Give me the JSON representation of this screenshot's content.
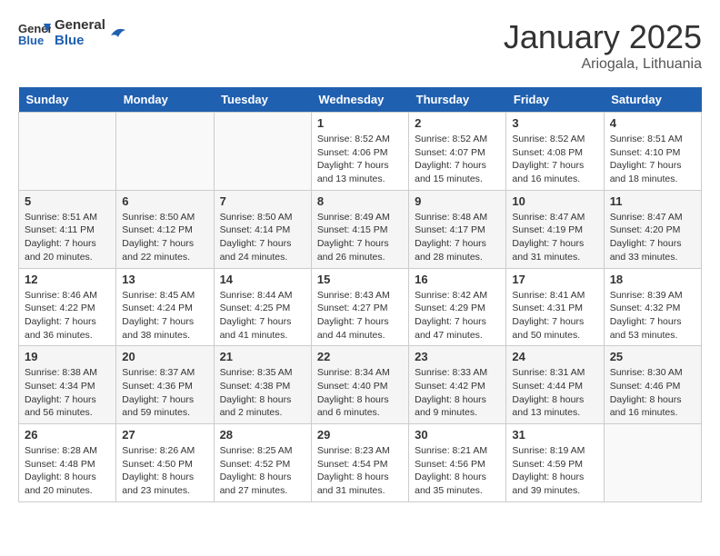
{
  "header": {
    "logo_general": "General",
    "logo_blue": "Blue",
    "month_title": "January 2025",
    "location": "Ariogala, Lithuania"
  },
  "days_of_week": [
    "Sunday",
    "Monday",
    "Tuesday",
    "Wednesday",
    "Thursday",
    "Friday",
    "Saturday"
  ],
  "weeks": [
    [
      {
        "day": "",
        "info": ""
      },
      {
        "day": "",
        "info": ""
      },
      {
        "day": "",
        "info": ""
      },
      {
        "day": "1",
        "info": "Sunrise: 8:52 AM\nSunset: 4:06 PM\nDaylight: 7 hours\nand 13 minutes."
      },
      {
        "day": "2",
        "info": "Sunrise: 8:52 AM\nSunset: 4:07 PM\nDaylight: 7 hours\nand 15 minutes."
      },
      {
        "day": "3",
        "info": "Sunrise: 8:52 AM\nSunset: 4:08 PM\nDaylight: 7 hours\nand 16 minutes."
      },
      {
        "day": "4",
        "info": "Sunrise: 8:51 AM\nSunset: 4:10 PM\nDaylight: 7 hours\nand 18 minutes."
      }
    ],
    [
      {
        "day": "5",
        "info": "Sunrise: 8:51 AM\nSunset: 4:11 PM\nDaylight: 7 hours\nand 20 minutes."
      },
      {
        "day": "6",
        "info": "Sunrise: 8:50 AM\nSunset: 4:12 PM\nDaylight: 7 hours\nand 22 minutes."
      },
      {
        "day": "7",
        "info": "Sunrise: 8:50 AM\nSunset: 4:14 PM\nDaylight: 7 hours\nand 24 minutes."
      },
      {
        "day": "8",
        "info": "Sunrise: 8:49 AM\nSunset: 4:15 PM\nDaylight: 7 hours\nand 26 minutes."
      },
      {
        "day": "9",
        "info": "Sunrise: 8:48 AM\nSunset: 4:17 PM\nDaylight: 7 hours\nand 28 minutes."
      },
      {
        "day": "10",
        "info": "Sunrise: 8:47 AM\nSunset: 4:19 PM\nDaylight: 7 hours\nand 31 minutes."
      },
      {
        "day": "11",
        "info": "Sunrise: 8:47 AM\nSunset: 4:20 PM\nDaylight: 7 hours\nand 33 minutes."
      }
    ],
    [
      {
        "day": "12",
        "info": "Sunrise: 8:46 AM\nSunset: 4:22 PM\nDaylight: 7 hours\nand 36 minutes."
      },
      {
        "day": "13",
        "info": "Sunrise: 8:45 AM\nSunset: 4:24 PM\nDaylight: 7 hours\nand 38 minutes."
      },
      {
        "day": "14",
        "info": "Sunrise: 8:44 AM\nSunset: 4:25 PM\nDaylight: 7 hours\nand 41 minutes."
      },
      {
        "day": "15",
        "info": "Sunrise: 8:43 AM\nSunset: 4:27 PM\nDaylight: 7 hours\nand 44 minutes."
      },
      {
        "day": "16",
        "info": "Sunrise: 8:42 AM\nSunset: 4:29 PM\nDaylight: 7 hours\nand 47 minutes."
      },
      {
        "day": "17",
        "info": "Sunrise: 8:41 AM\nSunset: 4:31 PM\nDaylight: 7 hours\nand 50 minutes."
      },
      {
        "day": "18",
        "info": "Sunrise: 8:39 AM\nSunset: 4:32 PM\nDaylight: 7 hours\nand 53 minutes."
      }
    ],
    [
      {
        "day": "19",
        "info": "Sunrise: 8:38 AM\nSunset: 4:34 PM\nDaylight: 7 hours\nand 56 minutes."
      },
      {
        "day": "20",
        "info": "Sunrise: 8:37 AM\nSunset: 4:36 PM\nDaylight: 7 hours\nand 59 minutes."
      },
      {
        "day": "21",
        "info": "Sunrise: 8:35 AM\nSunset: 4:38 PM\nDaylight: 8 hours\nand 2 minutes."
      },
      {
        "day": "22",
        "info": "Sunrise: 8:34 AM\nSunset: 4:40 PM\nDaylight: 8 hours\nand 6 minutes."
      },
      {
        "day": "23",
        "info": "Sunrise: 8:33 AM\nSunset: 4:42 PM\nDaylight: 8 hours\nand 9 minutes."
      },
      {
        "day": "24",
        "info": "Sunrise: 8:31 AM\nSunset: 4:44 PM\nDaylight: 8 hours\nand 13 minutes."
      },
      {
        "day": "25",
        "info": "Sunrise: 8:30 AM\nSunset: 4:46 PM\nDaylight: 8 hours\nand 16 minutes."
      }
    ],
    [
      {
        "day": "26",
        "info": "Sunrise: 8:28 AM\nSunset: 4:48 PM\nDaylight: 8 hours\nand 20 minutes."
      },
      {
        "day": "27",
        "info": "Sunrise: 8:26 AM\nSunset: 4:50 PM\nDaylight: 8 hours\nand 23 minutes."
      },
      {
        "day": "28",
        "info": "Sunrise: 8:25 AM\nSunset: 4:52 PM\nDaylight: 8 hours\nand 27 minutes."
      },
      {
        "day": "29",
        "info": "Sunrise: 8:23 AM\nSunset: 4:54 PM\nDaylight: 8 hours\nand 31 minutes."
      },
      {
        "day": "30",
        "info": "Sunrise: 8:21 AM\nSunset: 4:56 PM\nDaylight: 8 hours\nand 35 minutes."
      },
      {
        "day": "31",
        "info": "Sunrise: 8:19 AM\nSunset: 4:59 PM\nDaylight: 8 hours\nand 39 minutes."
      },
      {
        "day": "",
        "info": ""
      }
    ]
  ]
}
